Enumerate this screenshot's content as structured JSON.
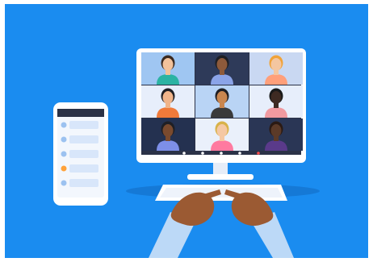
{
  "illustration": {
    "background_color": "#1a8cf0",
    "monitor_frame_color": "#ffffff",
    "monitor_bezel_color": "#2b3247",
    "tile_colors": [
      "#9fc6f2",
      "#2e3a59",
      "#c9d8f2",
      "#e7eefb",
      "#b9d4f5",
      "#e7eefb",
      "#243150",
      "#eaf0fb",
      "#2a3655"
    ],
    "call_controls": [
      "mic-icon",
      "camera-icon",
      "share-icon",
      "chat-icon",
      "end-call-icon"
    ],
    "phone_message_colors": [
      "#9cc2f0",
      "#9cc2f0",
      "#ffa23a",
      "#9cc2f0"
    ],
    "skin_tones": [
      "#f2c29b",
      "#8d5a3b",
      "#f4c6a0",
      "#f0b48a",
      "#c9864f",
      "#3e2a22",
      "#7a4a2e",
      "#f5c8a3",
      "#5b3a28"
    ],
    "hand_color": "#9b5a33",
    "sleeve_color": "#bcd9f7"
  }
}
